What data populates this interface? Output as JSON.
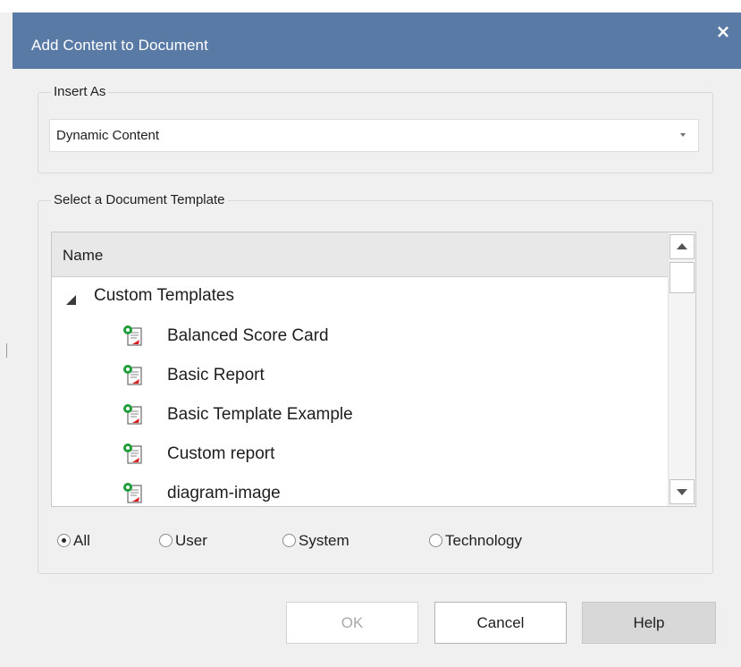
{
  "dialog": {
    "title": "Add Content to Document",
    "close_label": "×"
  },
  "insert_as": {
    "legend": "Insert As",
    "selected": "Dynamic Content"
  },
  "template_group": {
    "legend": "Select a Document Template",
    "column_header": "Name",
    "folder": "Custom Templates",
    "items": [
      "Balanced Score Card",
      "Basic Report",
      "Basic Template Example",
      "Custom report",
      "diagram-image"
    ]
  },
  "filters": {
    "selected": "All",
    "options": [
      "All",
      "User",
      "System",
      "Technology"
    ]
  },
  "buttons": {
    "ok": "OK",
    "cancel": "Cancel",
    "help": "Help"
  },
  "colors": {
    "titlebar": "#5a7aa6",
    "dialog_bg": "#f0f0f0",
    "icon_green": "#1f9d3a",
    "icon_red": "#d62020"
  },
  "icons": {
    "close": "close-icon",
    "dropdown": "chevron-down-icon",
    "expander": "expanded-triangle-icon",
    "template": "document-template-icon"
  }
}
